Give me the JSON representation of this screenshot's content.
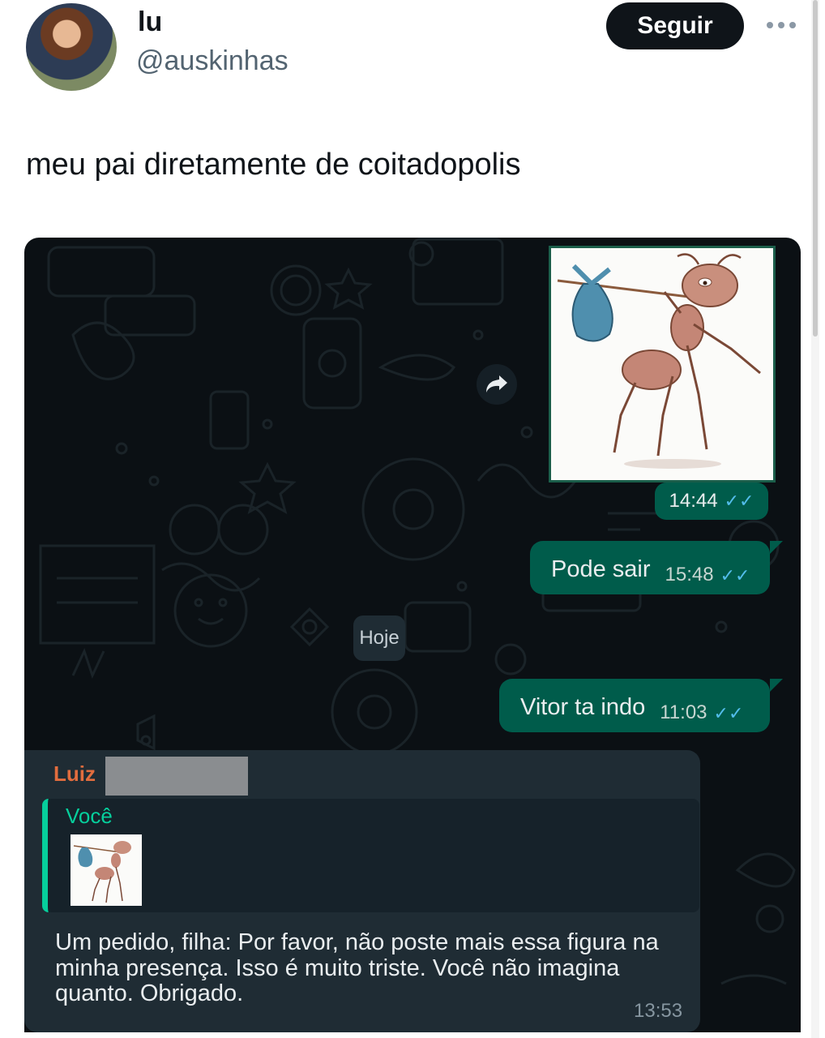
{
  "tweet": {
    "display_name": "lu",
    "handle": "@auskinhas",
    "follow_label": "Seguir",
    "more_icon": "more-horizontal-icon",
    "text": "meu pai diretamente de coitadopolis"
  },
  "chat": {
    "outgoing": [
      {
        "type": "image",
        "time": "14:44",
        "status": "read"
      },
      {
        "type": "text",
        "text": "Pode sair",
        "time": "15:48",
        "status": "read"
      },
      {
        "type": "text",
        "text": "Vitor ta indo",
        "time": "11:03",
        "status": "read"
      }
    ],
    "date_separator": "Hoje",
    "incoming": {
      "sender": "Luiz",
      "quoted_author": "Você",
      "text": "Um pedido, filha: Por favor, não poste mais essa figura na minha presença. Isso é muito triste. Você não imagina quanto. Obrigado.",
      "time": "13:53"
    },
    "colors": {
      "background": "#0b1014",
      "outgoing_bubble": "#005c4b",
      "incoming_bubble": "#1f2c34",
      "sender_name": "#e26d3e",
      "quote_accent": "#06cf9c",
      "read_ticks": "#53bdeb"
    }
  }
}
